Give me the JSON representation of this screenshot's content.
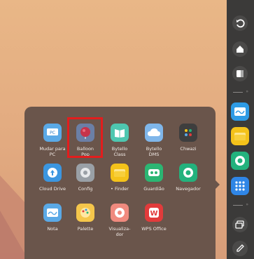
{
  "apps": [
    {
      "label": "Mudar para PC",
      "icon": "pc-switch-icon",
      "color": "#5aa9e6"
    },
    {
      "label": "Balloon Pop",
      "icon": "balloon-pop-icon",
      "color": "#6b7fa6"
    },
    {
      "label": "Bytello Class",
      "icon": "bytello-class-icon",
      "color": "#4ec7b0"
    },
    {
      "label": "Bytello DMS",
      "icon": "bytello-dms-icon",
      "color": "#7fb6ea"
    },
    {
      "label": "Chwazi",
      "icon": "chwazi-icon",
      "color": "#3e3e3e"
    },
    {
      "label": "Cloud Drive",
      "icon": "cloud-drive-icon",
      "color": "#3b96e0"
    },
    {
      "label": "Config",
      "icon": "settings-gear-icon",
      "color": "#9aa0a6"
    },
    {
      "label": "• Finder",
      "icon": "finder-folder-icon",
      "color": "#f4c21a"
    },
    {
      "label": "Guardião",
      "icon": "guardian-icon",
      "color": "#2bb673"
    },
    {
      "label": "Navegador",
      "icon": "browser-icon",
      "color": "#23b27d"
    },
    {
      "label": "Nota",
      "icon": "note-icon",
      "color": "#5aa9e6"
    },
    {
      "label": "Palette",
      "icon": "palette-icon",
      "color": "#f5c64b"
    },
    {
      "label": "Visualiza- dor",
      "icon": "viewer-icon",
      "color": "#f08a7e"
    },
    {
      "label": "WPS Office",
      "icon": "wps-office-icon",
      "color": "#e23b3b"
    }
  ],
  "dock": {
    "buttons": [
      {
        "icon": "back-icon"
      },
      {
        "icon": "home-icon"
      },
      {
        "icon": "recents-icon"
      }
    ],
    "separator_label": "»",
    "apps": [
      {
        "icon": "whiteboard-icon",
        "color": "#2e9be5"
      },
      {
        "icon": "finder-folder-icon",
        "color": "#f4c21a"
      },
      {
        "icon": "browser-icon",
        "color": "#23b27d"
      },
      {
        "icon": "app-grid-icon",
        "color": "#2f86e6"
      }
    ],
    "tools": [
      {
        "icon": "screen-share-icon"
      },
      {
        "icon": "pen-icon"
      }
    ]
  },
  "highlight_color": "#e31d1d"
}
